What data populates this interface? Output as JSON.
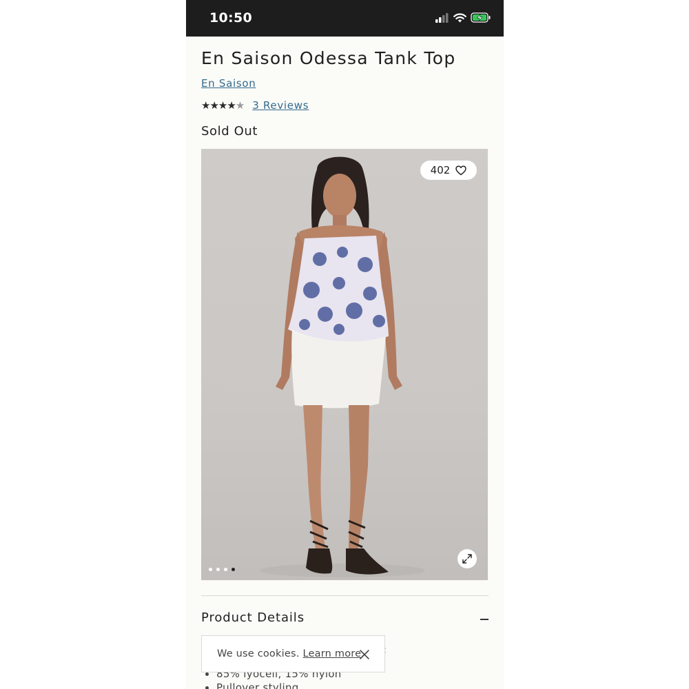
{
  "status_bar": {
    "time": "10:50",
    "icons": [
      "cellular-signal-icon",
      "wifi-icon",
      "battery-charging-icon"
    ],
    "battery_color": "#34c759"
  },
  "product": {
    "title": "En Saison Odessa Tank Top",
    "brand": "En Saison",
    "rating": {
      "value": 4,
      "max": 5,
      "reviews_label": "3 Reviews"
    },
    "stock_status": "Sold Out",
    "favorites_count": "402",
    "gallery": {
      "total_images": 4,
      "active_index": 3
    }
  },
  "details": {
    "header": "Product Details",
    "items": [
      "85% lyocell, 15% nylon",
      "Pullover styling"
    ]
  },
  "cookie_banner": {
    "text": "We use cookies.",
    "link_label": "Learn more",
    "suffix": "."
  },
  "colors": {
    "link": "#336a8c",
    "text": "#1f1f1f",
    "page_background": "#fbfbf8",
    "status_bar_background": "#1d1d1d"
  }
}
